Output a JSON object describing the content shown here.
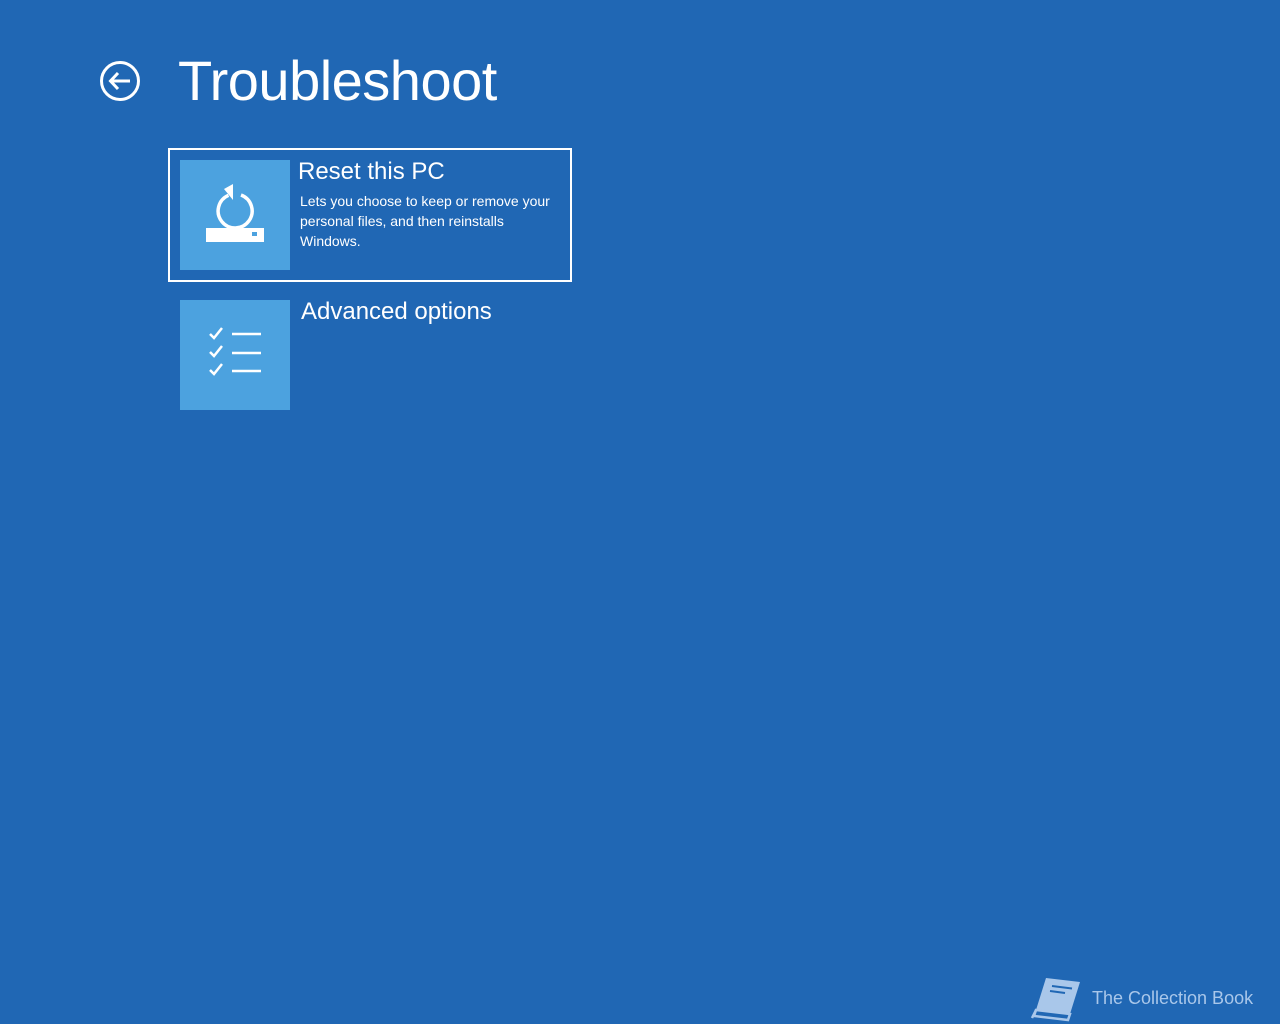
{
  "page": {
    "title": "Troubleshoot",
    "back_icon": "back-arrow-circle-icon"
  },
  "options": [
    {
      "title": "Reset this PC",
      "description": "Lets you choose to keep or remove your personal files, and then reinstalls Windows.",
      "icon": "reset-pc-icon",
      "selected": true
    },
    {
      "title": "Advanced options",
      "description": "",
      "icon": "checklist-icon",
      "selected": false
    }
  ],
  "watermark": {
    "text": "The Collection Book",
    "icon": "book-icon"
  },
  "colors": {
    "background": "#2067b4",
    "tile": "#4ca2df",
    "text": "#ffffff",
    "watermark": "#a9c7ea"
  }
}
